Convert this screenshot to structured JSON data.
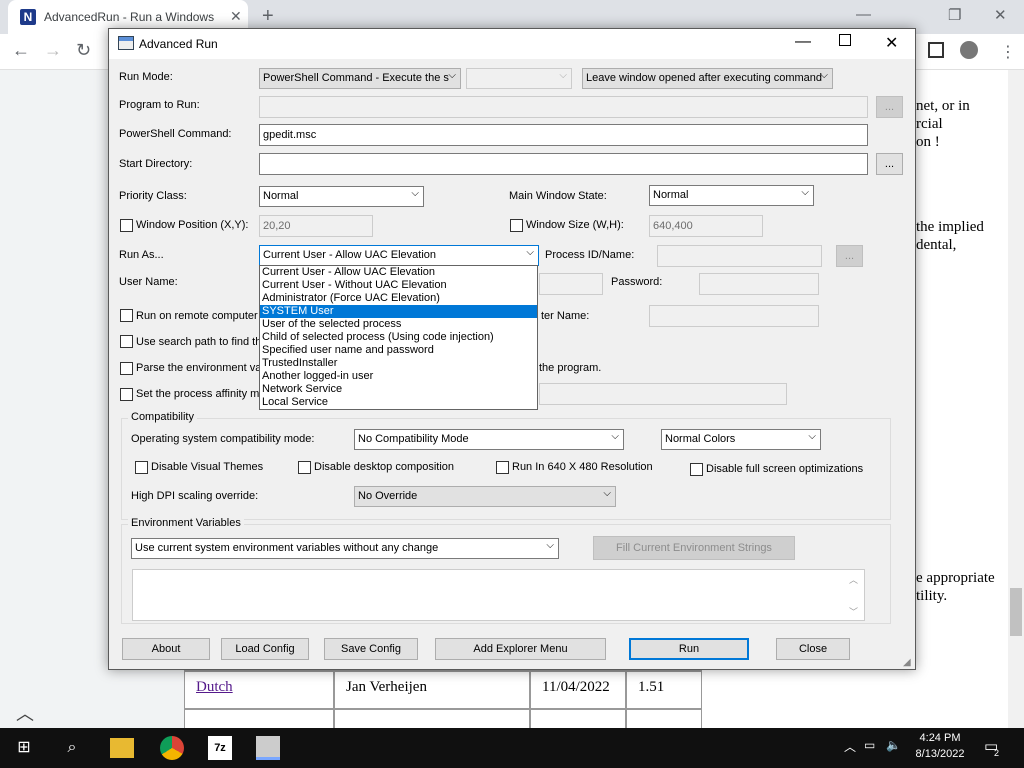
{
  "browser": {
    "tab_title": "AdvancedRun - Run a Windows p",
    "favicon_letter": "N",
    "page_text": [
      "net, or in",
      "rcial",
      "on !",
      "the implied",
      "dental,",
      "e appropriate",
      "tility."
    ],
    "table_rows": [
      {
        "lang": "Dutch",
        "translator": "Jan Verheijen",
        "date": "11/04/2022",
        "ver": "1.51"
      }
    ]
  },
  "dialog": {
    "title": "Advanced Run",
    "run_mode_label": "Run Mode:",
    "run_mode_value": "PowerShell Command - Execute the s",
    "window_option_value": "Leave window opened after executing command",
    "program_label": "Program to Run:",
    "powershell_label": "PowerShell Command:",
    "powershell_value": "gpedit.msc",
    "start_dir_label": "Start Directory:",
    "browse_label": "...",
    "priority_label": "Priority Class:",
    "priority_value": "Normal",
    "main_window_label": "Main Window State:",
    "main_window_value": "Normal",
    "window_pos_label": "Window Position (X,Y):",
    "window_pos_value": "20,20",
    "window_size_label": "Window Size (W,H):",
    "window_size_value": "640,400",
    "run_as_label": "Run As...",
    "run_as_value": "Current User - Allow UAC Elevation",
    "process_label": "Process ID/Name:",
    "username_label": "User Name:",
    "password_label": "Password:",
    "remote_label": "Run on remote computer",
    "remote_name_label": "ter Name:",
    "search_path_label": "Use search path to find th",
    "parse_env_label": "Parse the environment va",
    "parse_env_tail": "the program.",
    "affinity_label": "Set the process affinity m",
    "run_as_options": [
      "Current User - Allow UAC Elevation",
      "Current User - Without UAC Elevation",
      "Administrator (Force UAC Elevation)",
      "SYSTEM User",
      "User of the selected process",
      "Child of selected process (Using code injection)",
      "Specified user name and password",
      "TrustedInstaller",
      "Another logged-in user",
      "Network Service",
      "Local Service"
    ],
    "highlighted_option": "SYSTEM User",
    "compat": {
      "group_label": "Compatibility",
      "os_mode_label": "Operating system compatibility mode:",
      "os_mode_value": "No Compatibility Mode",
      "colors_value": "Normal Colors",
      "disable_themes": "Disable Visual Themes",
      "disable_desktop": "Disable desktop composition",
      "run_640": "Run In 640 X 480 Resolution",
      "disable_fullscreen": "Disable full screen optimizations",
      "dpi_label": "High DPI scaling override:",
      "dpi_value": "No Override"
    },
    "env": {
      "group_label": "Environment Variables",
      "mode_value": "Use current system environment variables without any change",
      "fill_button": "Fill Current Environment Strings"
    },
    "buttons": {
      "about": "About",
      "load": "Load Config",
      "save": "Save Config",
      "explorer": "Add Explorer Menu",
      "run": "Run",
      "close": "Close"
    }
  },
  "taskbar": {
    "time": "4:24 PM",
    "date": "8/13/2022",
    "notif_count": "2"
  }
}
